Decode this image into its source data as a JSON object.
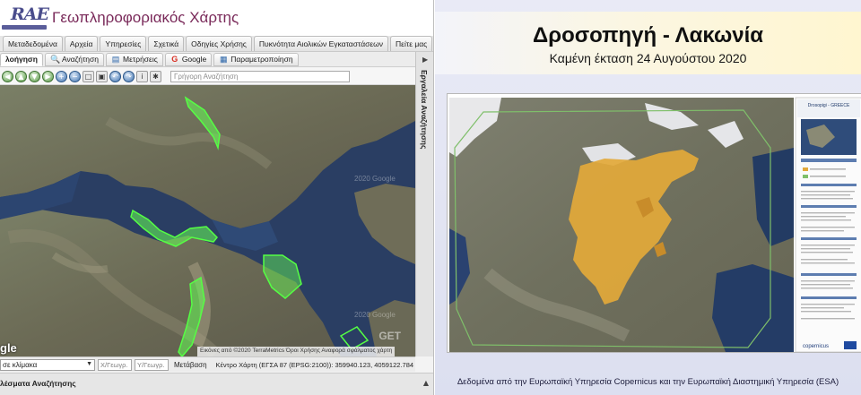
{
  "app": {
    "logo_text": "RAE",
    "title": "Γεωπληροφοριακός Χάρτης",
    "menu_tabs": [
      "Μεταδεδομένα",
      "Αρχεία",
      "Υπηρεσίες",
      "Σχετικά",
      "Οδηγίες Χρήσης",
      "Πυκνότητα Αιολικών Εγκαταστάσεων",
      "Πείτε μας"
    ],
    "tool_tabs": [
      {
        "label": "λοήγηση",
        "icon": "none",
        "active": true
      },
      {
        "label": "Αναζήτηση",
        "icon": "search-icon"
      },
      {
        "label": "Μετρήσεις",
        "icon": "ruler-icon"
      },
      {
        "label": "Google",
        "icon": "google-icon"
      },
      {
        "label": "Παραμετροποίηση",
        "icon": "settings-icon"
      }
    ],
    "quick_search_placeholder": "Γρήγορη Αναζήτηση",
    "side_panel_label": "Εργαλεία Αναζήτησης",
    "map_attribution": "Εικόνες από ©2020 TerraMetrics   Όροι Χρήσης   Αναφορά σφάλματος χάρτη",
    "google_mark": "gle",
    "watermark": "2020 Google",
    "getc_mark": "GET",
    "status": {
      "scale_select": "σε κλίμακα",
      "lon_placeholder": "Χ/Γεωγρ.",
      "lat_placeholder": "Υ/Γεωγρ.",
      "go_label": "Μετάβαση",
      "center_coords": "Κέντρο Χάρτη (ΕΓΣΑ 87 (EPSG:2100)): 359940.123, 4059122.784"
    },
    "results_label": "λέσματα Αναζήτησης"
  },
  "slide": {
    "title": "Δροσοπηγή - Λακωνία",
    "subtitle": "Καμένη έκταση 24 Αυγούστου 2020",
    "footer": "Δεδομένα από την Ευρωπαϊκή Υπηρεσία Copernicus και την Ευρωπαϊκή Διαστημική Υπηρεσία (ESA)",
    "map_legend_title": "Drosopigi - GREECE",
    "map_logo": "copernicus"
  },
  "colors": {
    "burn_area": "#e3a93a",
    "wind_markers": "#66ff55",
    "title_purple": "#7a2a5a"
  }
}
